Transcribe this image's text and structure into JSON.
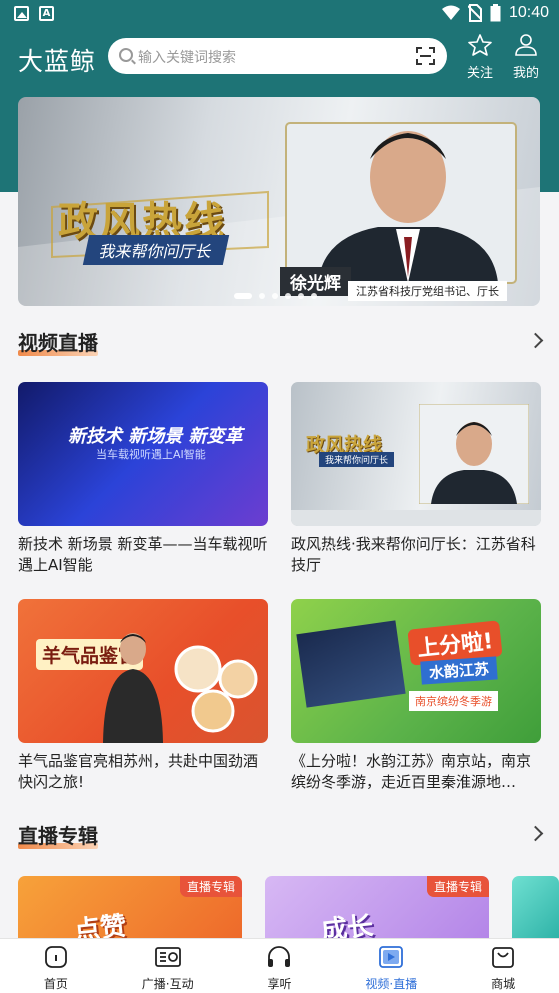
{
  "status_bar": {
    "time": "10:40",
    "icons": [
      "image-icon",
      "a-icon",
      "wifi-icon",
      "no-sim-icon",
      "battery-icon"
    ]
  },
  "header": {
    "app_name": "大蓝鲸",
    "search_placeholder": "输入关键词搜索",
    "follow_label": "关注",
    "me_label": "我的"
  },
  "banner": {
    "title": "政风热线",
    "subtitle": "我来帮你问厅长",
    "name": "徐光辉",
    "caption": "江苏省科技厅党组书记、厅长",
    "slides": 6,
    "active_slide": 1
  },
  "sections": {
    "video_live": {
      "title": "视频直播",
      "items": [
        {
          "title": "新技术 新场景 新变革——当车载视听遇上AI智能",
          "thumb_text": "新技术 新场景 新变革",
          "thumb_sub": "当车载视听遇上AI智能"
        },
        {
          "title": "政风热线·我来帮你问厅长：江苏省科技厅",
          "thumb_text": "政风热线",
          "thumb_sub": "我来帮你问厅长"
        },
        {
          "title": "羊气品鉴官亮相苏州，共赴中国劲酒快闪之旅!",
          "thumb_text": "羊气品鉴官"
        },
        {
          "title": "《上分啦！水韵江苏》南京站，南京缤纷冬季游，走近百里秦淮源地…",
          "thumb_text": "上分啦!",
          "thumb_mid": "水韵江苏",
          "thumb_sub": "南京缤纷冬季游"
        }
      ]
    },
    "live_albums": {
      "title": "直播专辑",
      "badge": "直播专辑",
      "items": [
        {
          "thumb_text": "点赞"
        },
        {
          "thumb_text": "成长"
        }
      ]
    }
  },
  "tabbar": {
    "items": [
      {
        "label": "首页",
        "icon": "home-icon"
      },
      {
        "label": "广播·互动",
        "icon": "radio-icon"
      },
      {
        "label": "享听",
        "icon": "headphones-icon"
      },
      {
        "label": "视频·直播",
        "icon": "video-play-icon",
        "active": true
      },
      {
        "label": "商城",
        "icon": "shopping-bag-icon"
      }
    ]
  },
  "colors": {
    "header_bg": "#1e7476",
    "accent": "#2f6fd8",
    "section_underline": "#f08a4b",
    "badge": "#e8533a"
  }
}
